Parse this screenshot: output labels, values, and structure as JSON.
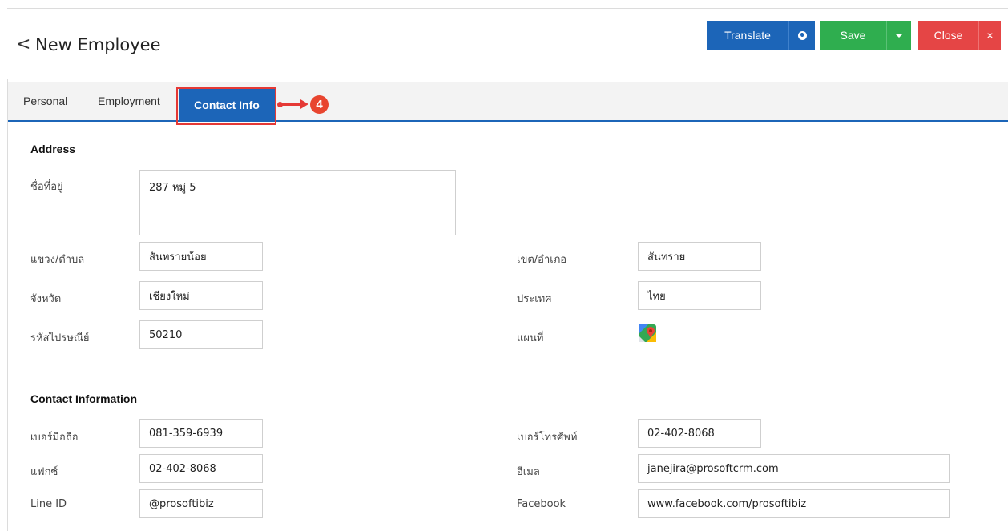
{
  "header": {
    "back_glyph": "<",
    "title": "New Employee",
    "translate_label": "Translate",
    "save_label": "Save",
    "close_label": "Close",
    "close_x": "×"
  },
  "tabs": [
    {
      "label": "Personal"
    },
    {
      "label": "Employment"
    },
    {
      "label": "Contact Info",
      "active": true
    }
  ],
  "annotation": {
    "step": "4"
  },
  "address": {
    "title": "Address",
    "address_label": "ชื่อที่อยู่",
    "address_value": "287 หมู่ 5",
    "subdistrict_label": "แขวง/ตำบล",
    "subdistrict_value": "สันทรายน้อย",
    "district_label": "เขต/อำเภอ",
    "district_value": "สันทราย",
    "province_label": "จังหวัด",
    "province_value": "เชียงใหม่",
    "country_label": "ประเทศ",
    "country_value": "ไทย",
    "postcode_label": "รหัสไปรษณีย์",
    "postcode_value": "50210",
    "map_label": "แผนที่"
  },
  "contact": {
    "title": "Contact Information",
    "mobile_label": "เบอร์มือถือ",
    "mobile_value": "081-359-6939",
    "phone_label": "เบอร์โทรศัพท์",
    "phone_value": "02-402-8068",
    "fax_label": "แฟกซ์",
    "fax_value": "02-402-8068",
    "email_label": "อีเมล",
    "email_value": "janejira@prosoftcrm.com",
    "line_label": "Line ID",
    "line_value": "@prosoftibiz",
    "facebook_label": "Facebook",
    "facebook_value": "www.facebook.com/prosoftibiz"
  },
  "colors": {
    "primary": "#1c65b8",
    "save": "#2fae4f",
    "close": "#e54545",
    "annotation": "#e53935"
  }
}
